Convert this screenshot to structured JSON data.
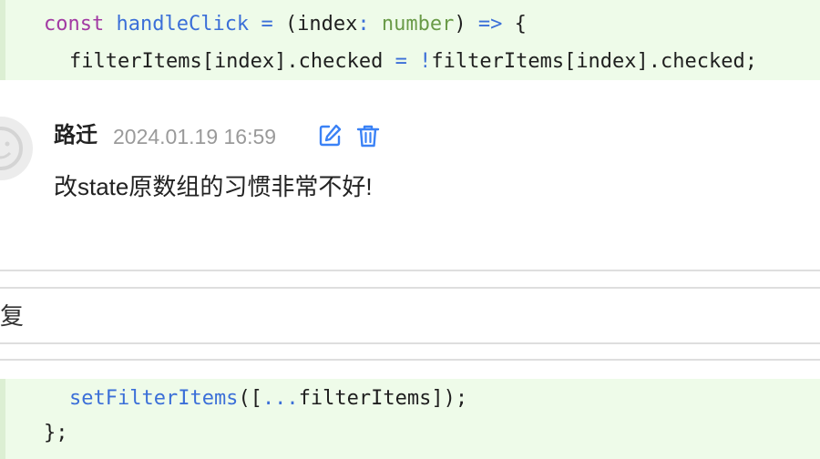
{
  "code_top": {
    "line1": {
      "kw": "const",
      "fn": "handleClick",
      "eq": "=",
      "open": "(index",
      "colon": ":",
      "type": "number",
      "close": ")",
      "arrow": "=>",
      "brace": "{"
    },
    "line2": {
      "a": "filterItems[index].checked",
      "eq": "=",
      "bang": "!",
      "b": "filterItems[index].checked;"
    }
  },
  "comment": {
    "author": "路迁",
    "timestamp": "2024.01.19 16:59",
    "text": "改state原数组的习惯非常不好!",
    "edit_icon": "edit-icon",
    "delete_icon": "trash-icon"
  },
  "reply": {
    "label": "复"
  },
  "code_bottom": {
    "line1": {
      "fn": "setFilterItems",
      "rest_open": "([",
      "spread": "...",
      "rest": "filterItems]);"
    },
    "line2": {
      "text": "};"
    }
  },
  "colors": {
    "code_bg": "#eefbe9",
    "keyword": "#a23aa3",
    "function": "#3b6fd8",
    "type": "#6a9b48",
    "icon_blue": "#3b82f6"
  }
}
